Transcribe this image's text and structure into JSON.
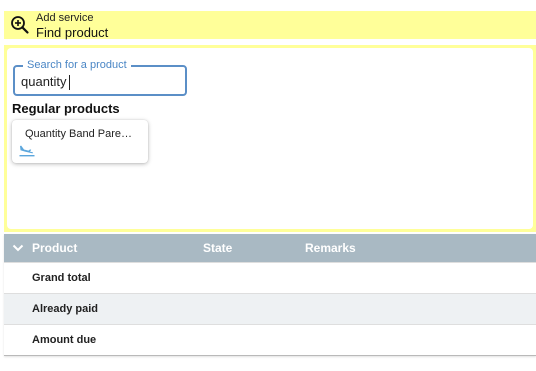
{
  "header": {
    "subtitle": "Add service",
    "title": "Find product",
    "icon": "zoom-in-icon"
  },
  "search": {
    "label": "Search for a product",
    "value": "quantity"
  },
  "results": {
    "heading": "Regular products",
    "items": [
      {
        "name": "Quantity Band Pare…",
        "icon": "flight-land-icon"
      }
    ]
  },
  "table": {
    "columns": [
      "Product",
      "State",
      "Remarks"
    ],
    "rows": [
      {
        "label": "Grand total"
      },
      {
        "label": "Already paid"
      },
      {
        "label": "Amount due"
      }
    ]
  },
  "colors": {
    "highlight": "#ffff99",
    "accent": "#4a86c5",
    "table_header": "#a9b9c3"
  }
}
